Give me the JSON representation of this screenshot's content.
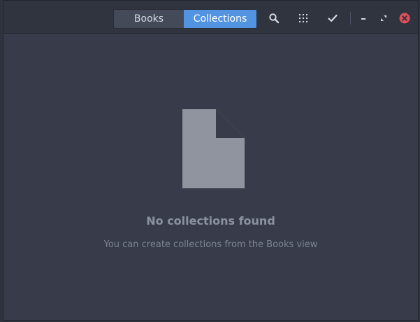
{
  "header": {
    "view_switcher": {
      "books_label": "Books",
      "collections_label": "Collections",
      "active": "Collections"
    },
    "buttons": {
      "search_icon": "search-icon",
      "view_mode_icon": "grid-icon",
      "selection_icon": "checkmark-icon",
      "minimize_icon": "minimize-icon",
      "maximize_icon": "maximize-icon",
      "close_icon": "close-icon"
    }
  },
  "empty_state": {
    "icon": "document-icon",
    "title": "No collections found",
    "subtitle": "You can create collections from the Books view"
  },
  "colors": {
    "accent": "#5294e2",
    "close_button": "#e04e58",
    "background": "#383c4a",
    "headerbar": "#2f343f"
  }
}
